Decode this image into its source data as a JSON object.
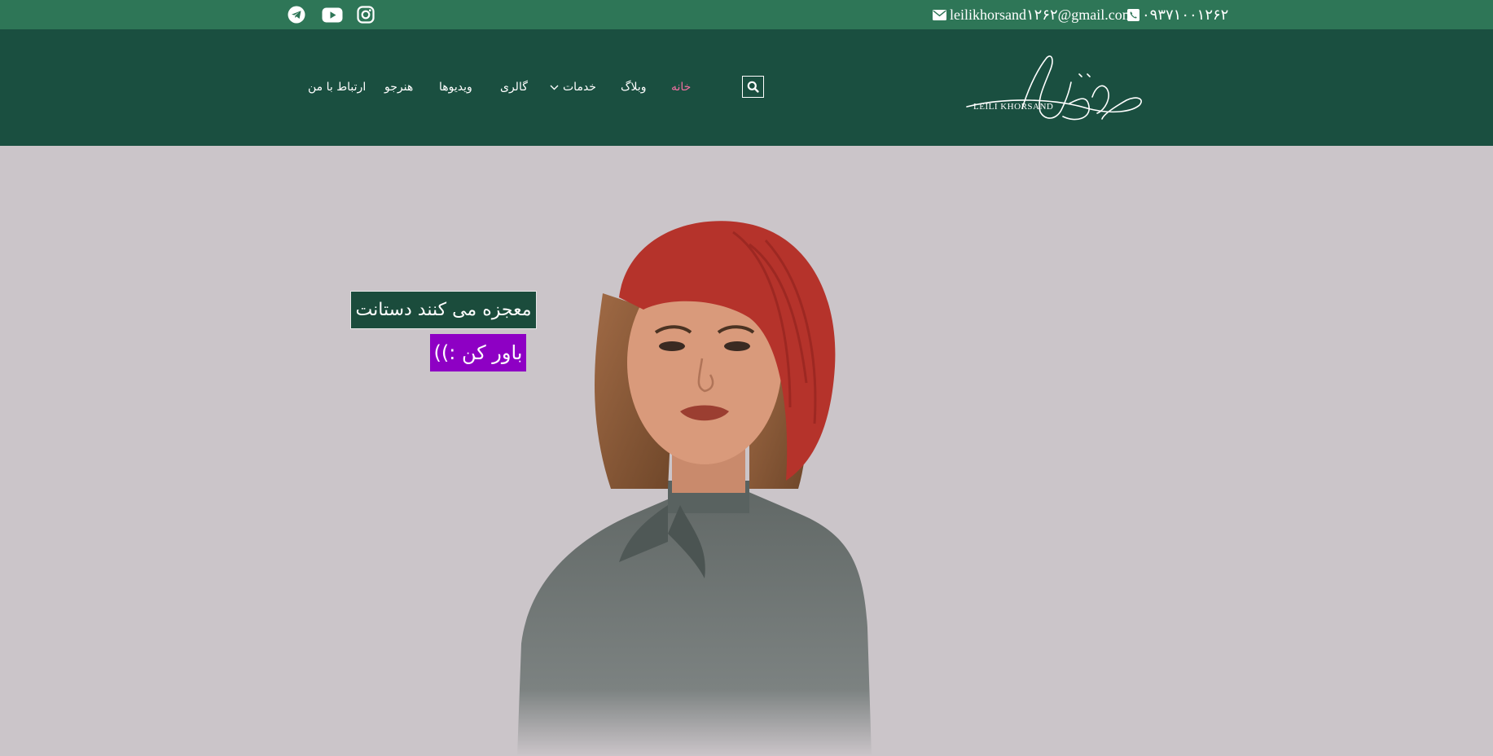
{
  "topbar": {
    "phone": "۰۹۳۷۱۰۰۱۲۶۲",
    "email": "leilikhorsand۱۲۶۲@gmail.com",
    "social": [
      "telegram-icon",
      "youtube-icon",
      "instagram-icon"
    ]
  },
  "header": {
    "logo_text": "LEILI KHORSAND",
    "nav": [
      {
        "label": "خانه",
        "active": true
      },
      {
        "label": "وبلاگ"
      },
      {
        "label": "خدمات",
        "has_dropdown": true
      },
      {
        "label": "گالری"
      },
      {
        "label": "ویدیوها"
      },
      {
        "label": "هنرجو"
      },
      {
        "label": "ارتباط با من"
      }
    ]
  },
  "hero": {
    "tagline_line1": "معجزه می کنند دستانت",
    "tagline_line2": "باور کن :))"
  },
  "colors": {
    "topbar": "#2e7657",
    "header": "#1a4f40",
    "active_nav": "#ef6fa0",
    "hero_bg": "#cbc5c9",
    "tag1_bg": "#1b4c3c",
    "tag2_bg": "#8e00c4"
  }
}
